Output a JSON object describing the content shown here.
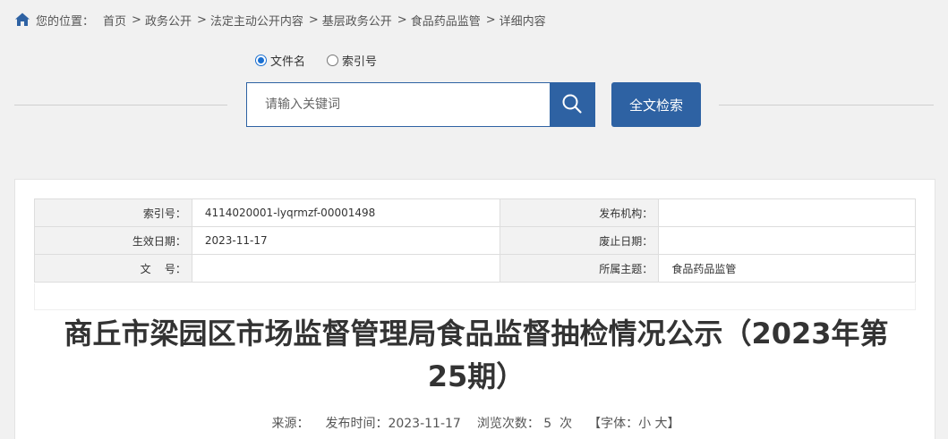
{
  "breadcrumb": {
    "prefix": "您的位置：",
    "items": [
      "首页",
      "政务公开",
      "法定主动公开内容",
      "基层政务公开",
      "食品药品监管",
      "详细内容"
    ],
    "separator": ">"
  },
  "search": {
    "type_options": [
      "文件名",
      "索引号"
    ],
    "selected_type": "文件名",
    "placeholder": "请输入关键词",
    "fulltext_label": "全文检索"
  },
  "meta": {
    "index_label": "索引号：",
    "index_value": "4114020001-lyqrmzf-00001498",
    "publisher_label": "发布机构：",
    "publisher_value": "",
    "effective_label": "生效日期：",
    "effective_value": "2023-11-17",
    "expiry_label": "废止日期：",
    "expiry_value": "",
    "docno_label": "文    号：",
    "docno_value": "",
    "topic_label": "所属主题：",
    "topic_value": "食品药品监管"
  },
  "article": {
    "title": "商丘市梁园区市场监督管理局食品监督抽检情况公示（2023年第25期）",
    "source_label": "来源：",
    "publish_time": "发布时间：2023-11-17",
    "views": "浏览次数： 5  次",
    "font_prefix": "【字体：",
    "font_small": "小",
    "font_large": "大",
    "font_suffix": "】"
  },
  "colors": {
    "accent": "#2e62a3",
    "page_bg": "#f1f1f1",
    "label_bg": "#f2f2f2"
  }
}
